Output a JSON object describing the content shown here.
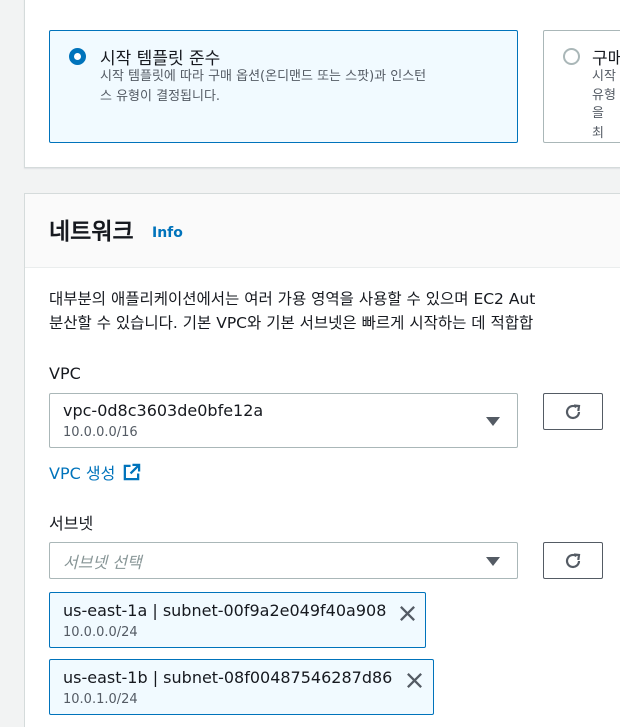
{
  "purchase": {
    "option_a_title": "시작 템플릿 준수",
    "option_a_desc_1": "시작 템플릿에 따라 구매 옵션(온디맨드 또는 스팟)과 인스턴",
    "option_a_desc_2": "스 유형이 결정됩니다.",
    "option_b_title": "구매",
    "option_b_desc_1": "시작",
    "option_b_desc_2": "유형",
    "option_b_desc_3": "을 최"
  },
  "network": {
    "title": "네트워크",
    "info": "Info",
    "desc_1": "대부분의 애플리케이션에서는 여러 가용 영역을 사용할 수 있으며 EC2 Aut",
    "desc_2": "분산할 수 있습니다. 기본 VPC와 기본 서브넷은 빠르게 시작하는 데 적합합"
  },
  "vpc": {
    "label": "VPC",
    "value": "vpc-0d8c3603de0bfe12a",
    "cidr": "10.0.0.0/16",
    "create_link": "VPC 생성"
  },
  "subnet": {
    "label": "서브넷",
    "placeholder": "서브넷 선택",
    "tokens": [
      {
        "label": "us-east-1a | subnet-00f9a2e049f40a908",
        "cidr": "10.0.0.0/24"
      },
      {
        "label": "us-east-1b | subnet-08f00487546287d86",
        "cidr": "10.0.1.0/24"
      }
    ]
  },
  "icons": {
    "refresh": "refresh-icon",
    "caret": "caret-down-icon",
    "external": "external-link-icon",
    "remove": "close-icon"
  },
  "colors": {
    "accent": "#0073bb",
    "selected_bg": "#f1faff"
  }
}
